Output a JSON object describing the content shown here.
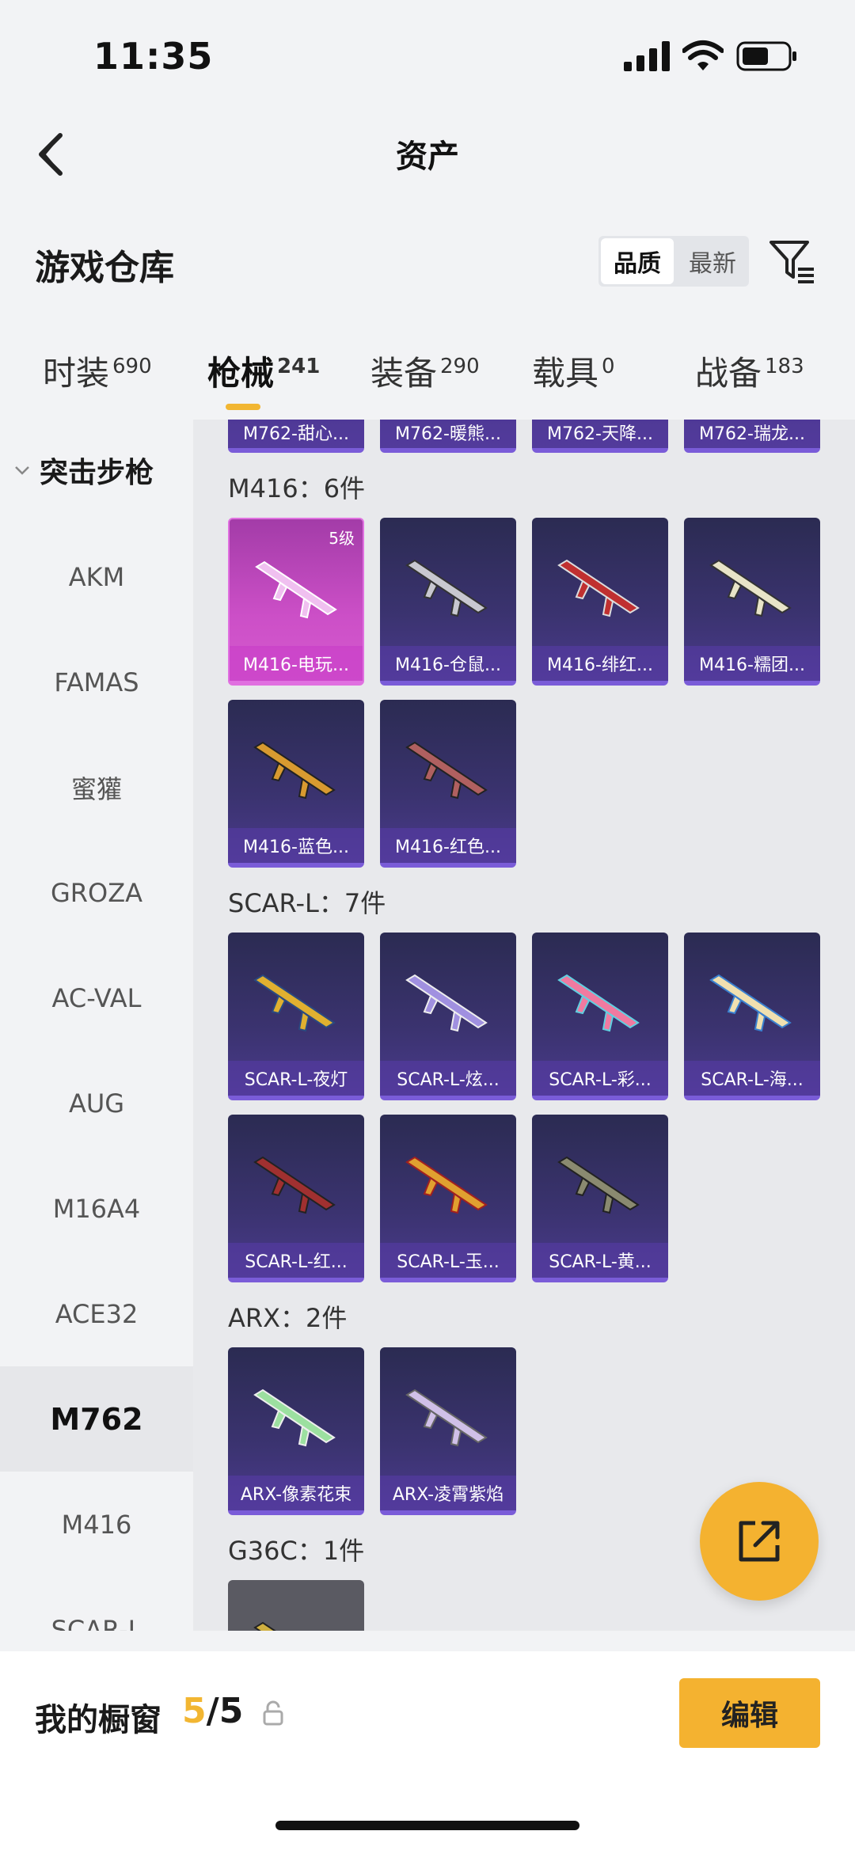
{
  "status": {
    "time": "11:35"
  },
  "nav": {
    "title": "资产"
  },
  "warehouse": {
    "title": "游戏仓库",
    "sort_quality": "品质",
    "sort_latest": "最新"
  },
  "tabs": [
    {
      "label": "时装",
      "count": "690"
    },
    {
      "label": "枪械",
      "count": "241"
    },
    {
      "label": "装备",
      "count": "290"
    },
    {
      "label": "载具",
      "count": "0"
    },
    {
      "label": "战备",
      "count": "183"
    }
  ],
  "sidebar": {
    "category": "突击步枪",
    "items": [
      "AKM",
      "FAMAS",
      "蜜獾",
      "GROZA",
      "AC-VAL",
      "AUG",
      "M16A4",
      "ACE32",
      "M762",
      "M416",
      "SCAR-L"
    ]
  },
  "content": {
    "top_row": [
      "M762-甜心...",
      "M762-暖熊...",
      "M762-天降...",
      "M762-瑞龙..."
    ],
    "sections": [
      {
        "label": "M416：6件",
        "items": [
          {
            "name": "M416-电玩...",
            "level": "5级"
          },
          {
            "name": "M416-仓鼠..."
          },
          {
            "name": "M416-绯红..."
          },
          {
            "name": "M416-糯团..."
          },
          {
            "name": "M416-蓝色..."
          },
          {
            "name": "M416-红色..."
          }
        ]
      },
      {
        "label": "SCAR-L：7件",
        "items": [
          {
            "name": "SCAR-L-夜灯"
          },
          {
            "name": "SCAR-L-炫..."
          },
          {
            "name": "SCAR-L-彩..."
          },
          {
            "name": "SCAR-L-海..."
          },
          {
            "name": "SCAR-L-红..."
          },
          {
            "name": "SCAR-L-玉..."
          },
          {
            "name": "SCAR-L-黄..."
          }
        ]
      },
      {
        "label": "ARX：2件",
        "items": [
          {
            "name": "ARX-像素花束"
          },
          {
            "name": "ARX-凌霄紫焰"
          }
        ]
      },
      {
        "label": "G36C：1件",
        "items": []
      }
    ]
  },
  "bottom": {
    "showcase_label": "我的橱窗",
    "showcase_used": "5",
    "showcase_total": "/5",
    "edit_label": "编辑"
  },
  "colors": {
    "accent": "#f2b632",
    "card_purple": "#3b3370",
    "card_pink": "#cc4fc7"
  }
}
